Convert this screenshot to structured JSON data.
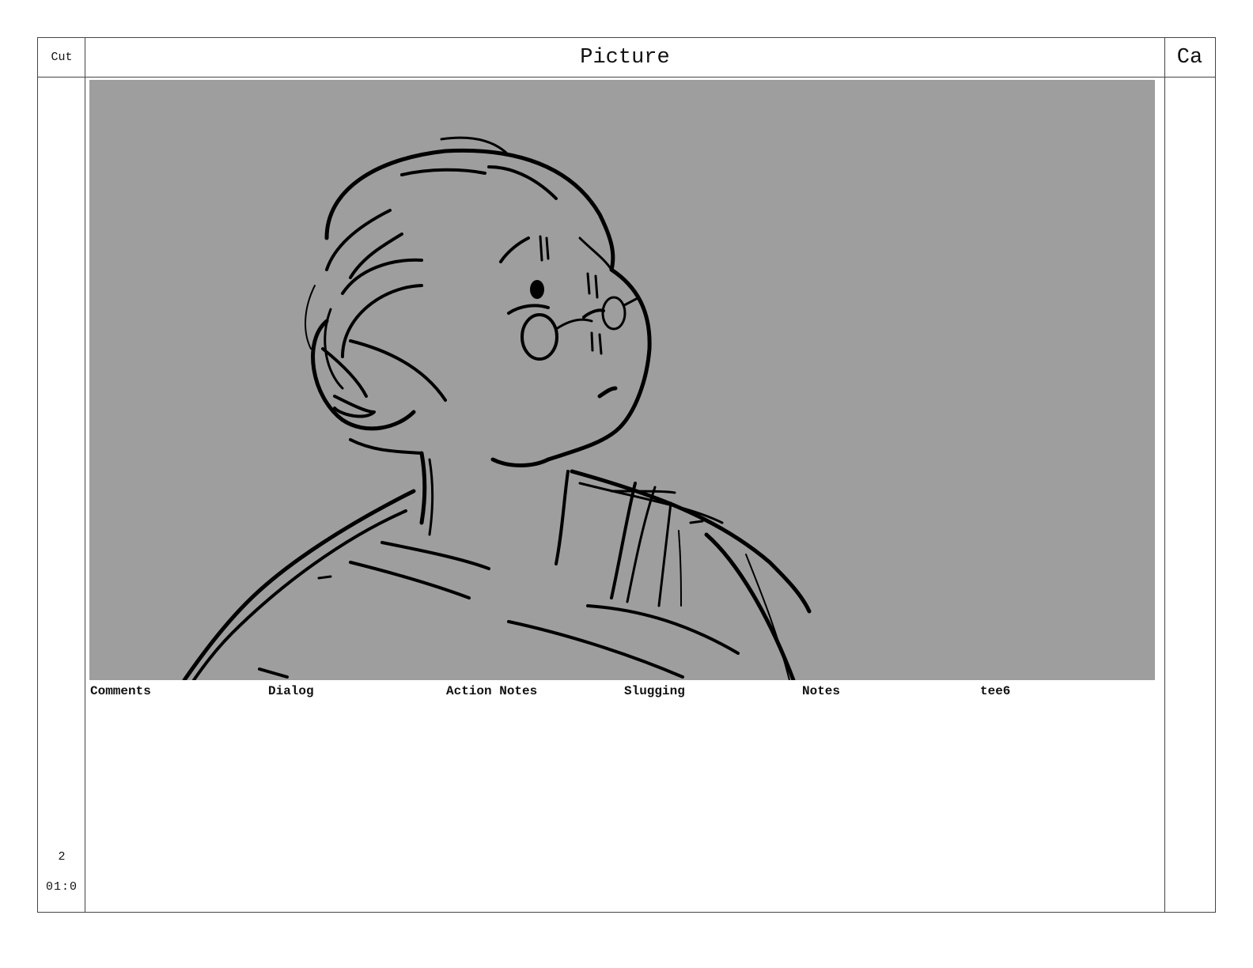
{
  "header": {
    "cut_label": "Cut",
    "picture_label": "Picture",
    "camera_label": "Ca"
  },
  "panel": {
    "background_color": "#9e9e9e",
    "drawing": "rough-sketch-character-looking-up-icon"
  },
  "fields": {
    "comments": "Comments",
    "dialog": "Dialog",
    "action_notes": "Action Notes",
    "slugging": "Slugging",
    "notes": "Notes",
    "custom": "tee6"
  },
  "cut": {
    "number": "2",
    "duration": "01:0"
  }
}
